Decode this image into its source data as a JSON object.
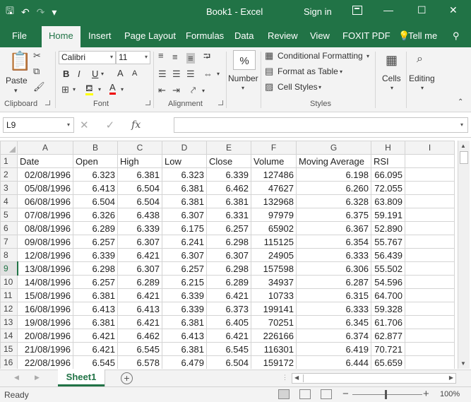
{
  "window": {
    "title": "Book1  -  Excel",
    "sign_in": "Sign in",
    "minimize": "—",
    "maximize": "☐",
    "close": "✕",
    "accent_color": "#217346"
  },
  "quick_access": {
    "save_icon": "🖫",
    "undo_icon": "↶",
    "redo_icon": "↷",
    "customize_icon": "▾"
  },
  "tabs": [
    {
      "label": "File"
    },
    {
      "label": "Home"
    },
    {
      "label": "Insert"
    },
    {
      "label": "Page Layout"
    },
    {
      "label": "Formulas"
    },
    {
      "label": "Data"
    },
    {
      "label": "Review"
    },
    {
      "label": "View"
    },
    {
      "label": "FOXIT PDF"
    },
    {
      "label": "Tell me"
    }
  ],
  "ribbon": {
    "clipboard": {
      "label": "Clipboard",
      "paste": "Paste"
    },
    "font": {
      "label": "Font",
      "name": "Calibri",
      "size": "11",
      "bold": "B",
      "italic": "I",
      "underline": "U",
      "grow": "A",
      "shrink": "A",
      "font_color": "A"
    },
    "alignment": {
      "label": "Alignment"
    },
    "number": {
      "label": "Number",
      "symbol": "%"
    },
    "styles": {
      "label": "Styles",
      "conditional": "Conditional Formatting",
      "table": "Format as Table",
      "cell_styles": "Cell Styles"
    },
    "cells": {
      "label": "Cells"
    },
    "editing": {
      "label": "Editing"
    }
  },
  "formula_bar": {
    "name_box": "L9",
    "cancel": "✕",
    "enter": "✓",
    "fx": "fx",
    "content": ""
  },
  "grid": {
    "columns": [
      "A",
      "B",
      "C",
      "D",
      "E",
      "F",
      "G",
      "H",
      "I"
    ],
    "headers": [
      "Date",
      "Open",
      "High",
      "Low",
      "Close",
      "Volume",
      "Moving Average",
      "RSI",
      ""
    ],
    "selected_row": 9,
    "rows": [
      [
        "02/08/1996",
        "6.323",
        "6.381",
        "6.323",
        "6.339",
        "127486",
        "6.198",
        "66.095"
      ],
      [
        "05/08/1996",
        "6.413",
        "6.504",
        "6.381",
        "6.462",
        "47627",
        "6.260",
        "72.055"
      ],
      [
        "06/08/1996",
        "6.504",
        "6.504",
        "6.381",
        "6.381",
        "132968",
        "6.328",
        "63.809"
      ],
      [
        "07/08/1996",
        "6.326",
        "6.438",
        "6.307",
        "6.331",
        "97979",
        "6.375",
        "59.191"
      ],
      [
        "08/08/1996",
        "6.289",
        "6.339",
        "6.175",
        "6.257",
        "65902",
        "6.367",
        "52.890"
      ],
      [
        "09/08/1996",
        "6.257",
        "6.307",
        "6.241",
        "6.298",
        "115125",
        "6.354",
        "55.767"
      ],
      [
        "12/08/1996",
        "6.339",
        "6.421",
        "6.307",
        "6.307",
        "24905",
        "6.333",
        "56.439"
      ],
      [
        "13/08/1996",
        "6.298",
        "6.307",
        "6.257",
        "6.298",
        "157598",
        "6.306",
        "55.502"
      ],
      [
        "14/08/1996",
        "6.257",
        "6.289",
        "6.215",
        "6.289",
        "34937",
        "6.287",
        "54.596"
      ],
      [
        "15/08/1996",
        "6.381",
        "6.421",
        "6.339",
        "6.421",
        "10733",
        "6.315",
        "64.700"
      ],
      [
        "16/08/1996",
        "6.413",
        "6.413",
        "6.339",
        "6.373",
        "199141",
        "6.333",
        "59.328"
      ],
      [
        "19/08/1996",
        "6.381",
        "6.421",
        "6.381",
        "6.405",
        "70251",
        "6.345",
        "61.706"
      ],
      [
        "20/08/1996",
        "6.421",
        "6.462",
        "6.413",
        "6.421",
        "226166",
        "6.374",
        "62.877"
      ],
      [
        "21/08/1996",
        "6.421",
        "6.545",
        "6.381",
        "6.545",
        "116301",
        "6.419",
        "70.721"
      ],
      [
        "22/08/1996",
        "6.545",
        "6.578",
        "6.479",
        "6.504",
        "159172",
        "6.444",
        "65.659"
      ]
    ]
  },
  "sheets": [
    {
      "label": "Sheet1"
    }
  ],
  "add_sheet": "+",
  "status": {
    "text": "Ready",
    "zoom": "100%",
    "zoom_minus": "−",
    "zoom_plus": "+"
  }
}
